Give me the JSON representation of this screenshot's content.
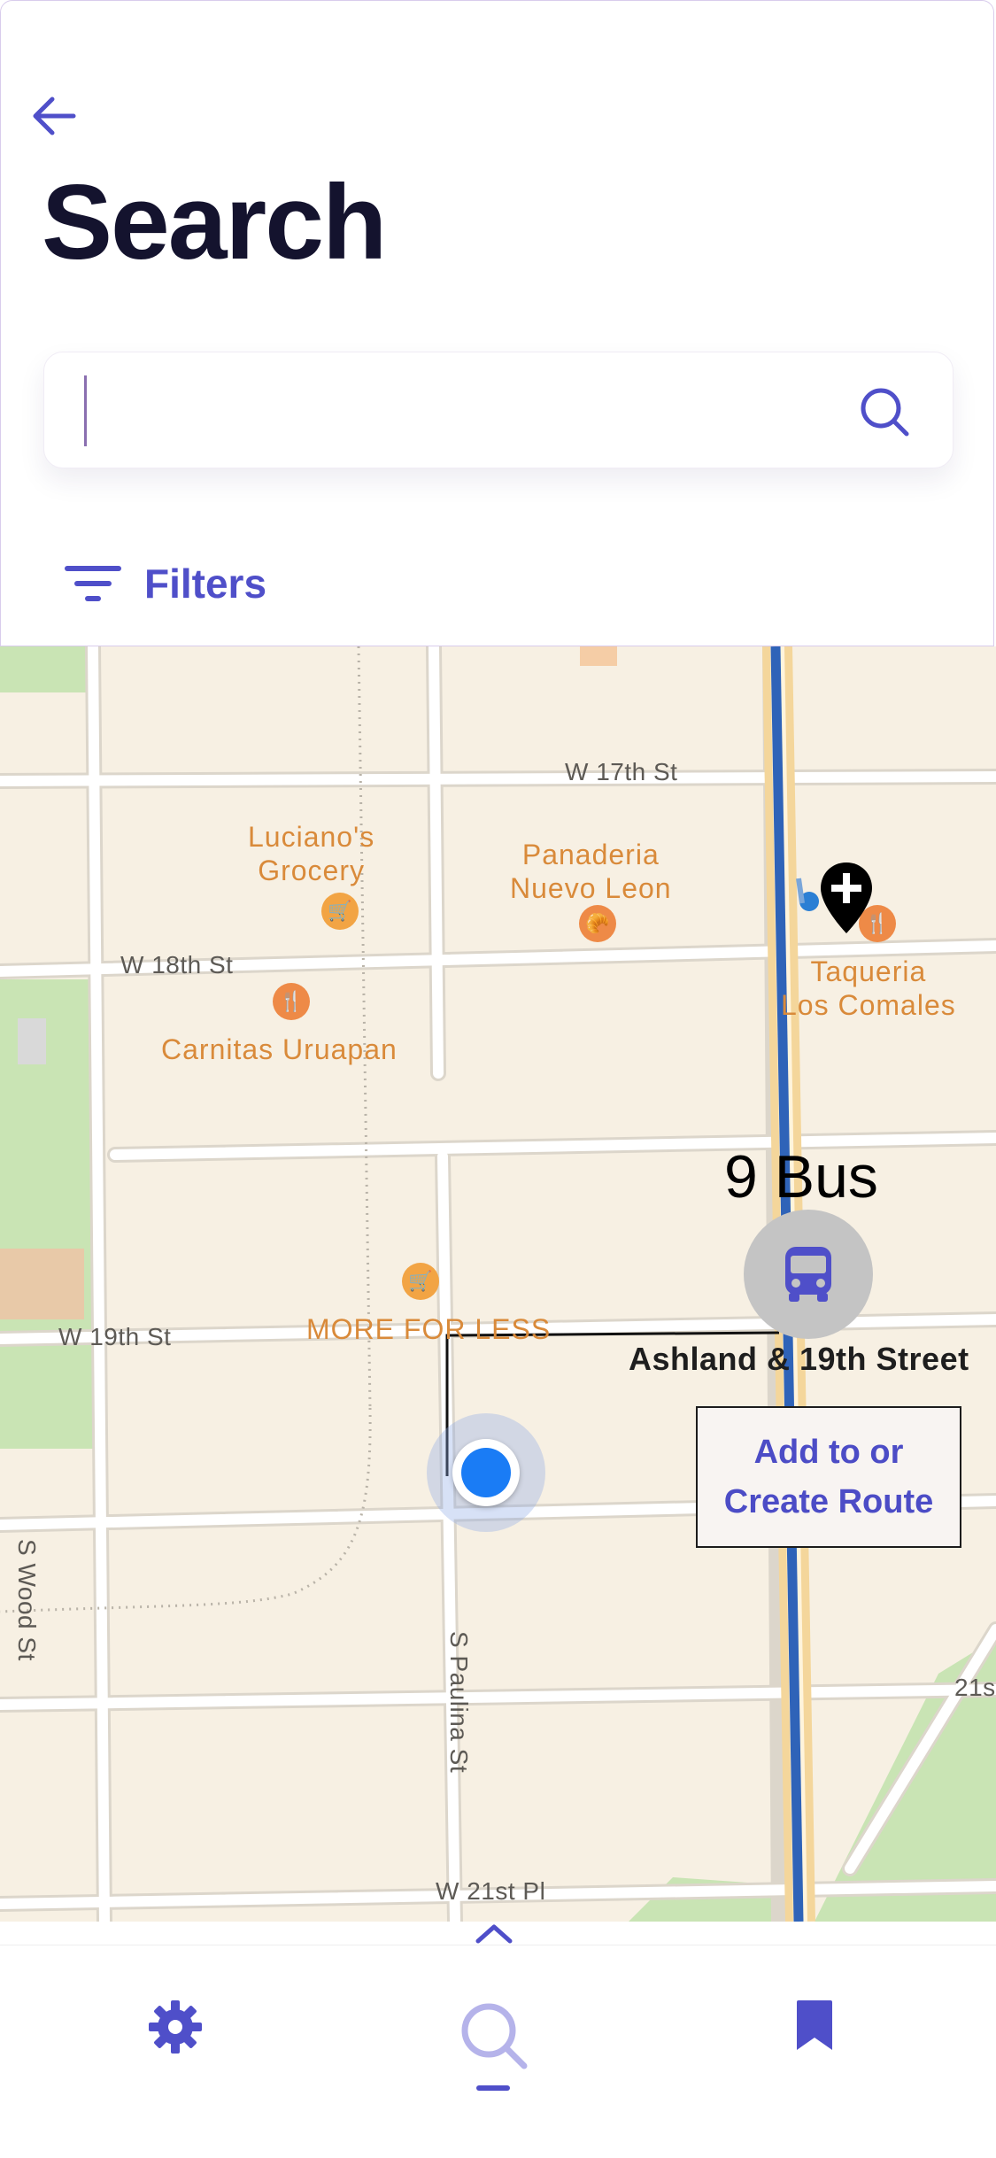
{
  "header": {
    "title": "Search",
    "search": {
      "value": "",
      "placeholder": ""
    },
    "filters_label": "Filters"
  },
  "map": {
    "streets": {
      "w17": "W 17th St",
      "w18": "W 18th St",
      "w19": "W 19th St",
      "w21": "W 21st Pl",
      "wood": "S Wood St",
      "paulina": "S Paulina St",
      "edge21": "21s"
    },
    "pois": {
      "lucianos": "Luciano's\nGrocery",
      "panaderia": "Panaderia\nNuevo Leon",
      "taqueria": "Taqueria\nLos Comales",
      "carnitas": "Carnitas Uruapan",
      "moreforless": "MORE FOR LESS"
    },
    "route_name": "9 Bus",
    "stop_name": "Ashland & 19th Street",
    "route_card": "Add to or\nCreate Route"
  },
  "colors": {
    "accent": "#4f4fc9",
    "title": "#14132e",
    "map_bg": "#f7f0e3",
    "route_line": "#2f63b8",
    "user_location": "#1a7cf5"
  },
  "icons": {
    "back": "arrow-left-icon",
    "search": "search-icon",
    "filters": "filter-lines-icon",
    "bus": "bus-icon",
    "pin": "pin-plus-icon",
    "settings": "gear-icon",
    "saved": "bookmark-icon",
    "handle": "chevron-up-icon"
  },
  "nav": {
    "active": "search"
  }
}
